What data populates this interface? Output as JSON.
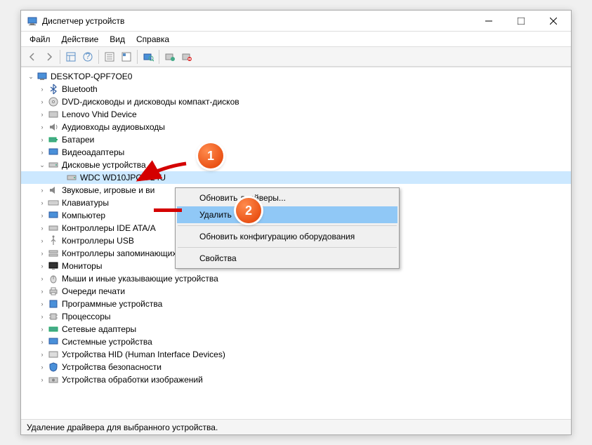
{
  "window": {
    "title": "Диспетчер устройств"
  },
  "menubar": {
    "file": "Файл",
    "action": "Действие",
    "view": "Вид",
    "help": "Справка"
  },
  "tree": {
    "root": "DESKTOP-QPF7OE0",
    "bluetooth": "Bluetooth",
    "dvd": "DVD-дисководы и дисководы компакт-дисков",
    "lenovo": "Lenovo Vhid Device",
    "audio": "Аудиовходы аудиовыходы",
    "battery": "Батареи",
    "video": "Видеоадаптеры",
    "disk": "Дисковые устройства",
    "disk_child": "WDC WD10JPCX-24U",
    "sound": "Звуковые, игровые и ви",
    "keyboard": "Клавиатуры",
    "computer": "Компьютер",
    "ide": "Контроллеры IDE ATA/A",
    "usb": "Контроллеры USB",
    "storage": "Контроллеры запоминающих устройств",
    "monitor": "Мониторы",
    "mouse": "Мыши и иные указывающие устройства",
    "print": "Очереди печати",
    "software": "Программные устройства",
    "cpu": "Процессоры",
    "network": "Сетевые адаптеры",
    "system": "Системные устройства",
    "hid": "Устройства HID (Human Interface Devices)",
    "security": "Устройства безопасности",
    "imaging": "Устройства обработки изображений"
  },
  "context": {
    "update_drivers": "Обновить драйверы...",
    "delete": "Удалить",
    "scan": "Обновить конфигурацию оборудования",
    "properties": "Свойства"
  },
  "statusbar": {
    "text": "Удаление драйвера для выбранного устройства."
  },
  "callouts": {
    "one": "1",
    "two": "2"
  }
}
